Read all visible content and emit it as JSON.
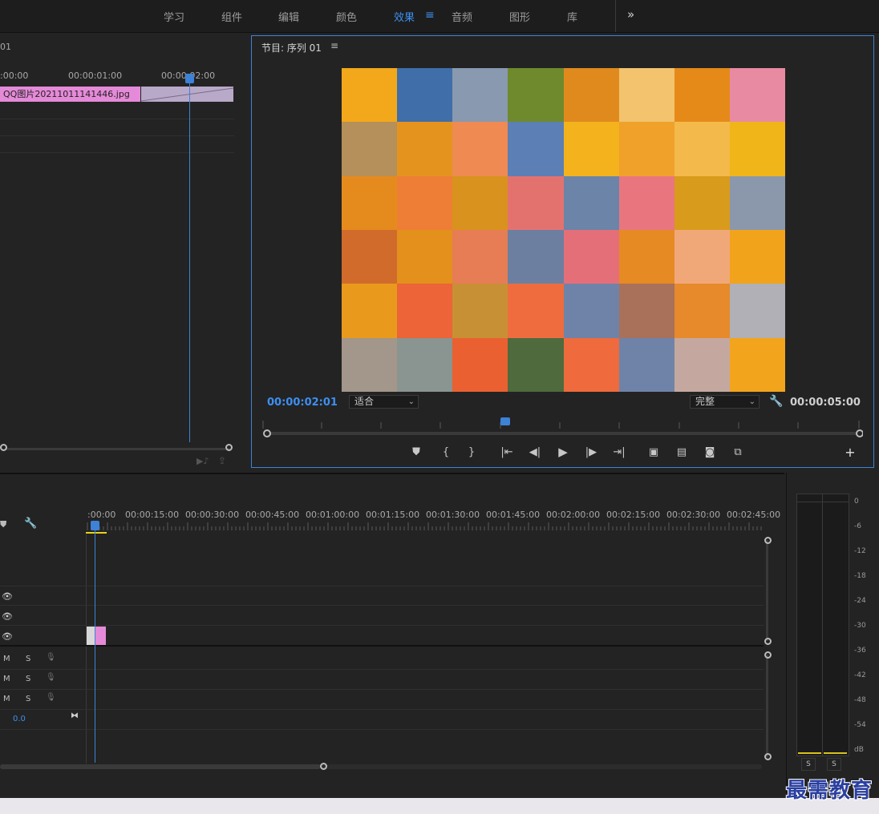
{
  "workspace_tabs": [
    "学习",
    "组件",
    "编辑",
    "颜色",
    "效果",
    "音频",
    "图形",
    "库"
  ],
  "active_tab": "效果",
  "overflow_icon": "»",
  "source": {
    "title_fragment": "01",
    "timecodes": [
      ":00:00",
      "00:00:01:00",
      "00:00:02:00"
    ],
    "clip_name": "QQ图片20211011141446.jpg"
  },
  "program": {
    "title": "节目: 序列 01",
    "menu_icon": "≡",
    "current_tc": "00:00:02:01",
    "fit_option": "适合",
    "quality_option": "完整",
    "duration_tc": "00:00:05:00",
    "controls": [
      "marker",
      "in",
      "out",
      "go-in",
      "step-back",
      "play",
      "step-forward",
      "go-out",
      "lift",
      "extract",
      "export-frame",
      "compare"
    ],
    "add_icon": "+"
  },
  "timeline": {
    "timecodes": [
      ":00:00",
      "00:00:15:00",
      "00:00:30:00",
      "00:00:45:00",
      "00:01:00:00",
      "00:01:15:00",
      "00:01:30:00",
      "00:01:45:00",
      "00:02:00:00",
      "00:02:15:00",
      "00:02:30:00",
      "00:02:45:00"
    ],
    "audio_labels": [
      "M",
      "S"
    ],
    "master_value": "0.0"
  },
  "meter": {
    "db_labels": [
      "0",
      "-6",
      "-12",
      "-18",
      "-24",
      "-30",
      "-36",
      "-42",
      "-48",
      "-54",
      "dB"
    ],
    "solo_labels": [
      "S",
      "S"
    ]
  },
  "watermark": "最需教育",
  "mosaic_colors": [
    "#f2a81a",
    "#3f6ea9",
    "#8899b0",
    "#6f8a2d",
    "#e08a1e",
    "#f3c36e",
    "#e58a18",
    "#e98aa3",
    "#b5905a",
    "#e5931f",
    "#ef8a52",
    "#5c7fb6",
    "#f4b21c",
    "#f0a12a",
    "#f3b94b",
    "#f0b519",
    "#e58b1e",
    "#ee7e35",
    "#d9921d",
    "#e3726f",
    "#6b84a8",
    "#e9757f",
    "#d99b1c",
    "#8b98ab",
    "#d06b2b",
    "#e3901d",
    "#e67d55",
    "#6d7fa1",
    "#e56f78",
    "#e68a24",
    "#f1a879",
    "#f2a31c",
    "#e99a1c",
    "#ec6438",
    "#c89035",
    "#ef6c3f",
    "#6f83a8",
    "#a9705a",
    "#e68a2b",
    "#b0b0b6",
    "#a3968a",
    "#8a9490",
    "#ea6031",
    "#4f6a3d",
    "#ef6a3c",
    "#6f83a8",
    "#c4a8a0",
    "#f2a41c"
  ]
}
